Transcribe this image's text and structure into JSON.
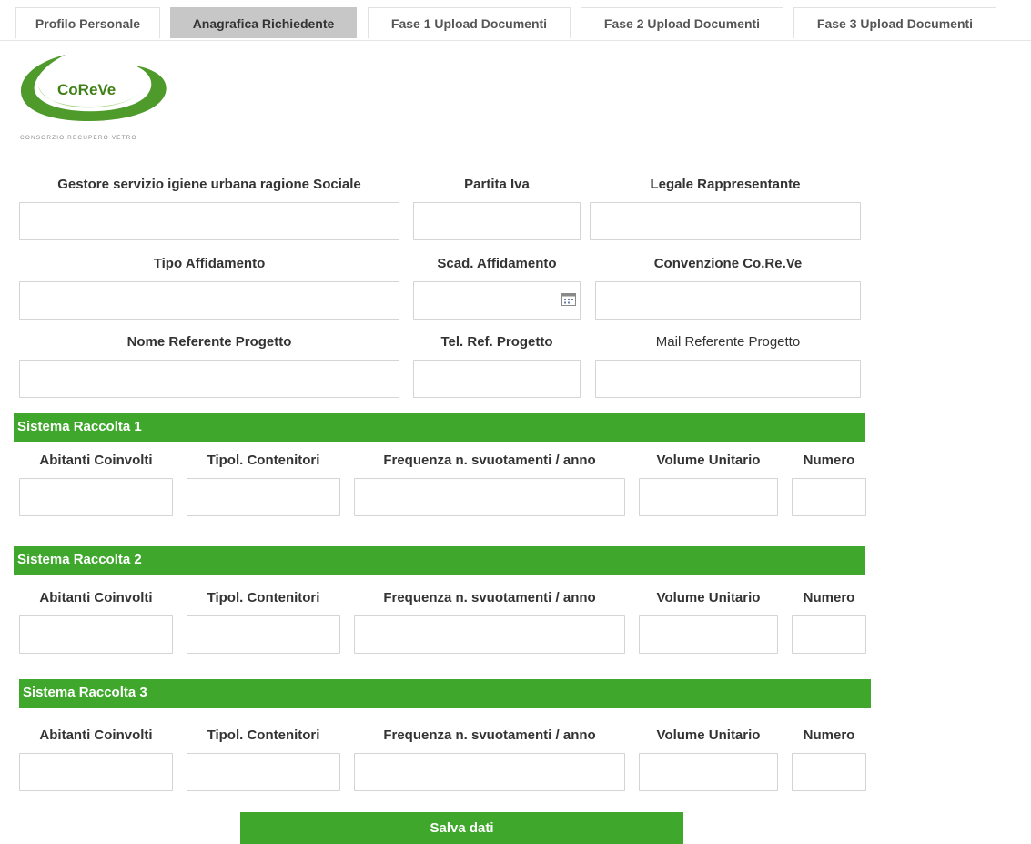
{
  "tabs": [
    {
      "label": "Profilo Personale"
    },
    {
      "label": "Anagrafica Richiedente"
    },
    {
      "label": "Fase 1 Upload Documenti"
    },
    {
      "label": "Fase 2 Upload Documenti"
    },
    {
      "label": "Fase 3 Upload Documenti"
    }
  ],
  "logo": {
    "name": "CoReVe",
    "subtitle": "CONSORZIO RECUPERO VETRO"
  },
  "form": {
    "gestore_label": "Gestore servizio igiene urbana ragione Sociale",
    "partita_iva_label": "Partita Iva",
    "legale_label": "Legale Rappresentante",
    "tipo_affidamento_label": "Tipo Affidamento",
    "scad_affidamento_label": "Scad. Affidamento",
    "convenzione_label": "Convenzione Co.Re.Ve",
    "nome_referente_label": "Nome Referente Progetto",
    "tel_ref_label": "Tel. Ref. Progetto",
    "mail_referente_label": "Mail Referente Progetto"
  },
  "sistemi": [
    {
      "title": "Sistema Raccolta 1"
    },
    {
      "title": "Sistema Raccolta 2"
    },
    {
      "title": "Sistema Raccolta 3"
    }
  ],
  "sistema_columns": {
    "abitanti": "Abitanti Coinvolti",
    "tipol": "Tipol. Contenitori",
    "frequenza": "Frequenza n. svuotamenti / anno",
    "volume": "Volume Unitario",
    "numero": "Numero"
  },
  "save_label": "Salva dati",
  "colors": {
    "accent": "#3fa82c",
    "tab_active": "#c7c7c7",
    "logo_green": "#4e9a2a"
  }
}
